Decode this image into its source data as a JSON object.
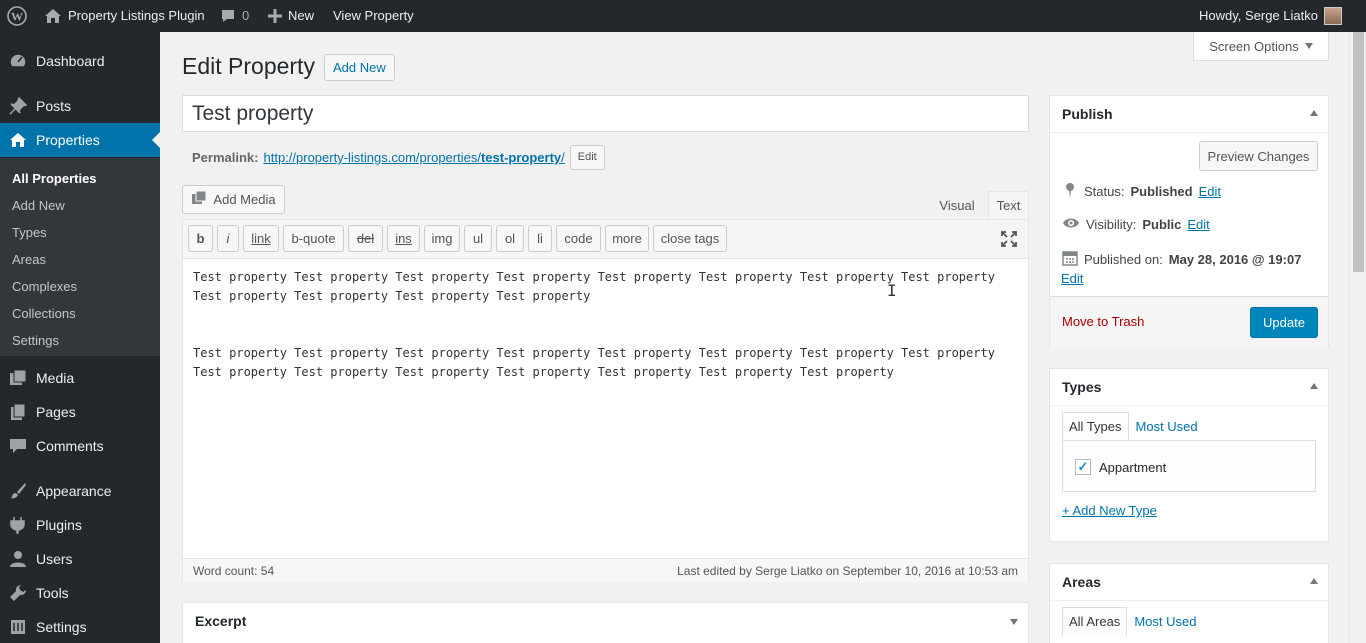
{
  "admin_bar": {
    "site_name": "Property Listings Plugin",
    "comments_count": "0",
    "new_label": "New",
    "view_label": "View Property",
    "greeting": "Howdy, Serge Liatko"
  },
  "sidebar": {
    "items": [
      {
        "label": "Dashboard",
        "icon": "dashboard-icon"
      },
      {
        "label": "Posts",
        "icon": "pin-icon"
      },
      {
        "label": "Properties",
        "icon": "home-icon"
      },
      {
        "label": "Media",
        "icon": "media-icon"
      },
      {
        "label": "Pages",
        "icon": "pages-icon"
      },
      {
        "label": "Comments",
        "icon": "comments-icon"
      },
      {
        "label": "Appearance",
        "icon": "brush-icon"
      },
      {
        "label": "Plugins",
        "icon": "plugin-icon"
      },
      {
        "label": "Users",
        "icon": "user-icon"
      },
      {
        "label": "Tools",
        "icon": "wrench-icon"
      },
      {
        "label": "Settings",
        "icon": "settings-icon"
      }
    ],
    "submenu": [
      "All Properties",
      "Add New",
      "Types",
      "Areas",
      "Complexes",
      "Collections",
      "Settings"
    ]
  },
  "screen_options": "Screen Options",
  "page": {
    "title": "Edit Property",
    "add_new": "Add New",
    "post_title": "Test property",
    "permalink_label": "Permalink:",
    "permalink_base": "http://property-listings.com/properties/",
    "permalink_slug": "test-property",
    "permalink_end": "/",
    "permalink_edit": "Edit"
  },
  "editor": {
    "add_media": "Add Media",
    "tab_visual": "Visual",
    "tab_text": "Text",
    "quicktags": [
      "b",
      "i",
      "link",
      "b-quote",
      "del",
      "ins",
      "img",
      "ul",
      "ol",
      "li",
      "code",
      "more",
      "close tags"
    ],
    "content": "Test property Test property Test property Test property Test property Test property Test property Test property\nTest property Test property Test property Test property\n\n\nTest property Test property Test property Test property Test property Test property Test property Test property\nTest property Test property Test property Test property Test property Test property Test property",
    "word_count": "Word count: 54",
    "last_edited": "Last edited by Serge Liatko on September 10, 2016 at 10:53 am"
  },
  "excerpt": {
    "title": "Excerpt"
  },
  "publish": {
    "title": "Publish",
    "preview": "Preview Changes",
    "status_label": "Status:",
    "status_value": "Published",
    "visibility_label": "Visibility:",
    "visibility_value": "Public",
    "published_label": "Published on:",
    "published_value": "May 28, 2016 @ 19:07",
    "edit": "Edit",
    "trash": "Move to Trash",
    "update": "Update"
  },
  "types_box": {
    "title": "Types",
    "tab_all": "All Types",
    "tab_used": "Most Used",
    "item": "Appartment",
    "add_new": "+ Add New Type"
  },
  "areas_box": {
    "title": "Areas",
    "tab_all": "All Areas",
    "tab_used": "Most Used"
  },
  "colors": {
    "accent": "#0073aa",
    "primary_button": "#0085ba",
    "admin_dark": "#23282d",
    "trash_red": "#a00"
  }
}
